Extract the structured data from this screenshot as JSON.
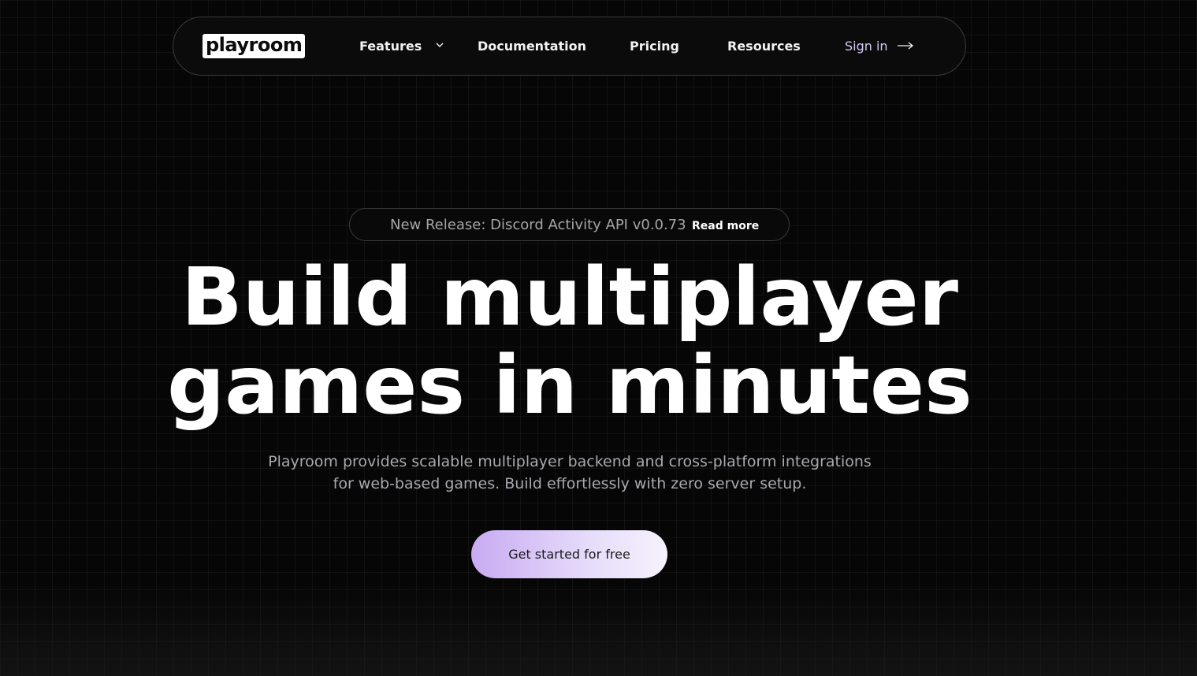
{
  "nav": {
    "logo": "playroom",
    "items": [
      {
        "label": "Features"
      },
      {
        "label": "Documentation"
      },
      {
        "label": "Pricing"
      },
      {
        "label": "Resources"
      }
    ],
    "signin": "Sign in"
  },
  "release": {
    "text": "New Release: Discord Activity API v0.0.73",
    "link": "Read more"
  },
  "hero": {
    "headline_line1": "Build multiplayer",
    "headline_line2": "games in minutes",
    "subtitle_line1": "Playroom provides scalable multiplayer backend and cross-platform integrations",
    "subtitle_line2": "for web-based games. Build effortlessly with zero server setup.",
    "cta": "Get started for free"
  },
  "colors": {
    "background": "#060606",
    "accent": "#c8aaf2",
    "signin": "#d7c8f7"
  }
}
